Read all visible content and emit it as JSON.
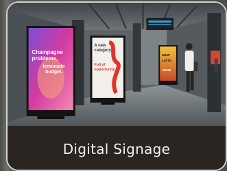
{
  "card": {
    "label": "Digital Signage"
  },
  "scene": {
    "screens": [
      {
        "headline_1": "Champagne",
        "headline_2": "problems,",
        "body_1": "lemonade",
        "body_2": "budget."
      },
      {
        "headline_1": "A new",
        "headline_2": "category",
        "body_1": "Full of",
        "body_2": "opportunity"
      },
      {
        "headline_1": "NEW",
        "headline_2": "LISTS",
        "body_1": "NOW"
      }
    ]
  },
  "colors": {
    "caption_bg": "#2b2521",
    "caption_text": "#f2f0ee",
    "border": "#d2d2cf",
    "accent_red": "#e2342c",
    "accent_pink": "#d63aa0"
  }
}
